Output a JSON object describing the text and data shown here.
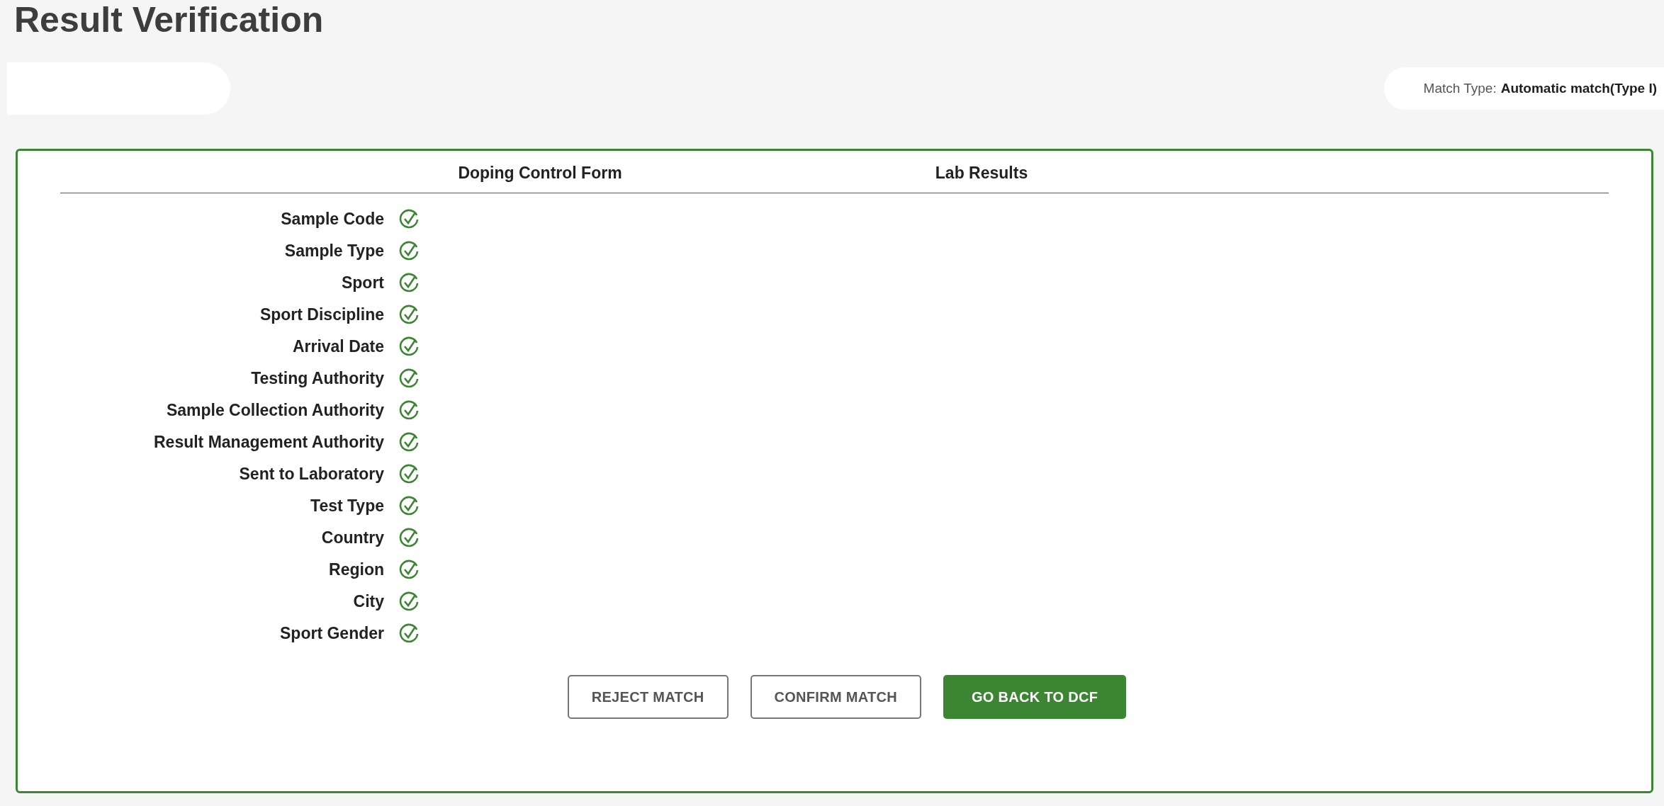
{
  "page_title": "Result Verification",
  "match_type": {
    "label": "Match Type:",
    "value": "Automatic match(Type I)"
  },
  "columns": [
    "Doping Control Form",
    "Lab Results"
  ],
  "rows": [
    {
      "label": "Sample Code",
      "matched": true
    },
    {
      "label": "Sample Type",
      "matched": true
    },
    {
      "label": "Sport",
      "matched": true
    },
    {
      "label": "Sport Discipline",
      "matched": true
    },
    {
      "label": "Arrival Date",
      "matched": true
    },
    {
      "label": "Testing Authority",
      "matched": true
    },
    {
      "label": "Sample Collection Authority",
      "matched": true
    },
    {
      "label": "Result Management Authority",
      "matched": true
    },
    {
      "label": "Sent to Laboratory",
      "matched": true
    },
    {
      "label": "Test Type",
      "matched": true
    },
    {
      "label": "Country",
      "matched": true
    },
    {
      "label": "Region",
      "matched": true
    },
    {
      "label": "City",
      "matched": true
    },
    {
      "label": "Sport Gender",
      "matched": true
    }
  ],
  "buttons": [
    {
      "label": "REJECT MATCH",
      "kind": "outline"
    },
    {
      "label": "CONFIRM MATCH",
      "kind": "outline"
    },
    {
      "label": "GO BACK TO DCF",
      "kind": "primary"
    }
  ]
}
